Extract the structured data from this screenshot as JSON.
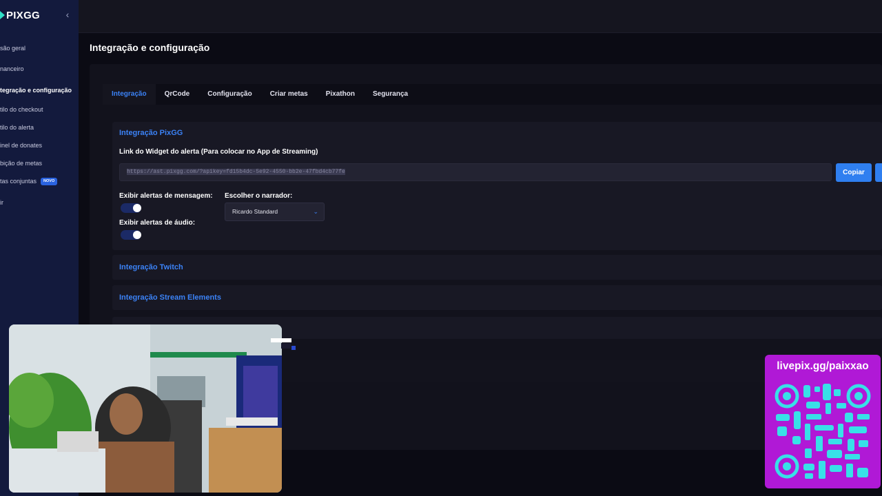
{
  "brand": {
    "name": "PIXGG"
  },
  "sidebar": {
    "items": [
      {
        "label": "são geral"
      },
      {
        "label": "nanceiro"
      },
      {
        "label": "tegração e configuração"
      },
      {
        "label": "tilo do checkout"
      },
      {
        "label": "tilo do alerta"
      },
      {
        "label": "inel de donates"
      },
      {
        "label": "bição de metas"
      },
      {
        "label": "tas conjuntas",
        "badge": "NOVO"
      },
      {
        "label": "ir"
      }
    ]
  },
  "page": {
    "title": "Integração e configuração"
  },
  "tabs": [
    {
      "label": "Integração",
      "active": true
    },
    {
      "label": "QrCode"
    },
    {
      "label": "Configuração"
    },
    {
      "label": "Criar metas"
    },
    {
      "label": "Pixathon"
    },
    {
      "label": "Segurança"
    }
  ],
  "pixgg_card": {
    "title": "Integração PixGG",
    "widget_label": "Link do Widget do alerta (Para colocar no App de Streaming)",
    "widget_url": "https://ast.pixgg.com/?apikey=fd15b4dc-5e92-4550-bb2e-47fbd4cb77fe",
    "copy_label": "Copiar",
    "message_alerts_label": "Exibir alertas de mensagem:",
    "audio_alerts_label": "Exibir alertas de áudio:",
    "narrator_label": "Escolher o narrador:",
    "narrator_value": "Ricardo Standard"
  },
  "twitch_card": {
    "title": "Integração Twitch"
  },
  "stream_elements_card": {
    "title": "Integração Stream Elements"
  },
  "overlay": {
    "qr_label": "livepix.gg/paixxao"
  },
  "colors": {
    "accent": "#3b82f6",
    "sidebar": "#131a3d",
    "qr_bg": "#b019d6",
    "qr_fg": "#38e0e8"
  }
}
